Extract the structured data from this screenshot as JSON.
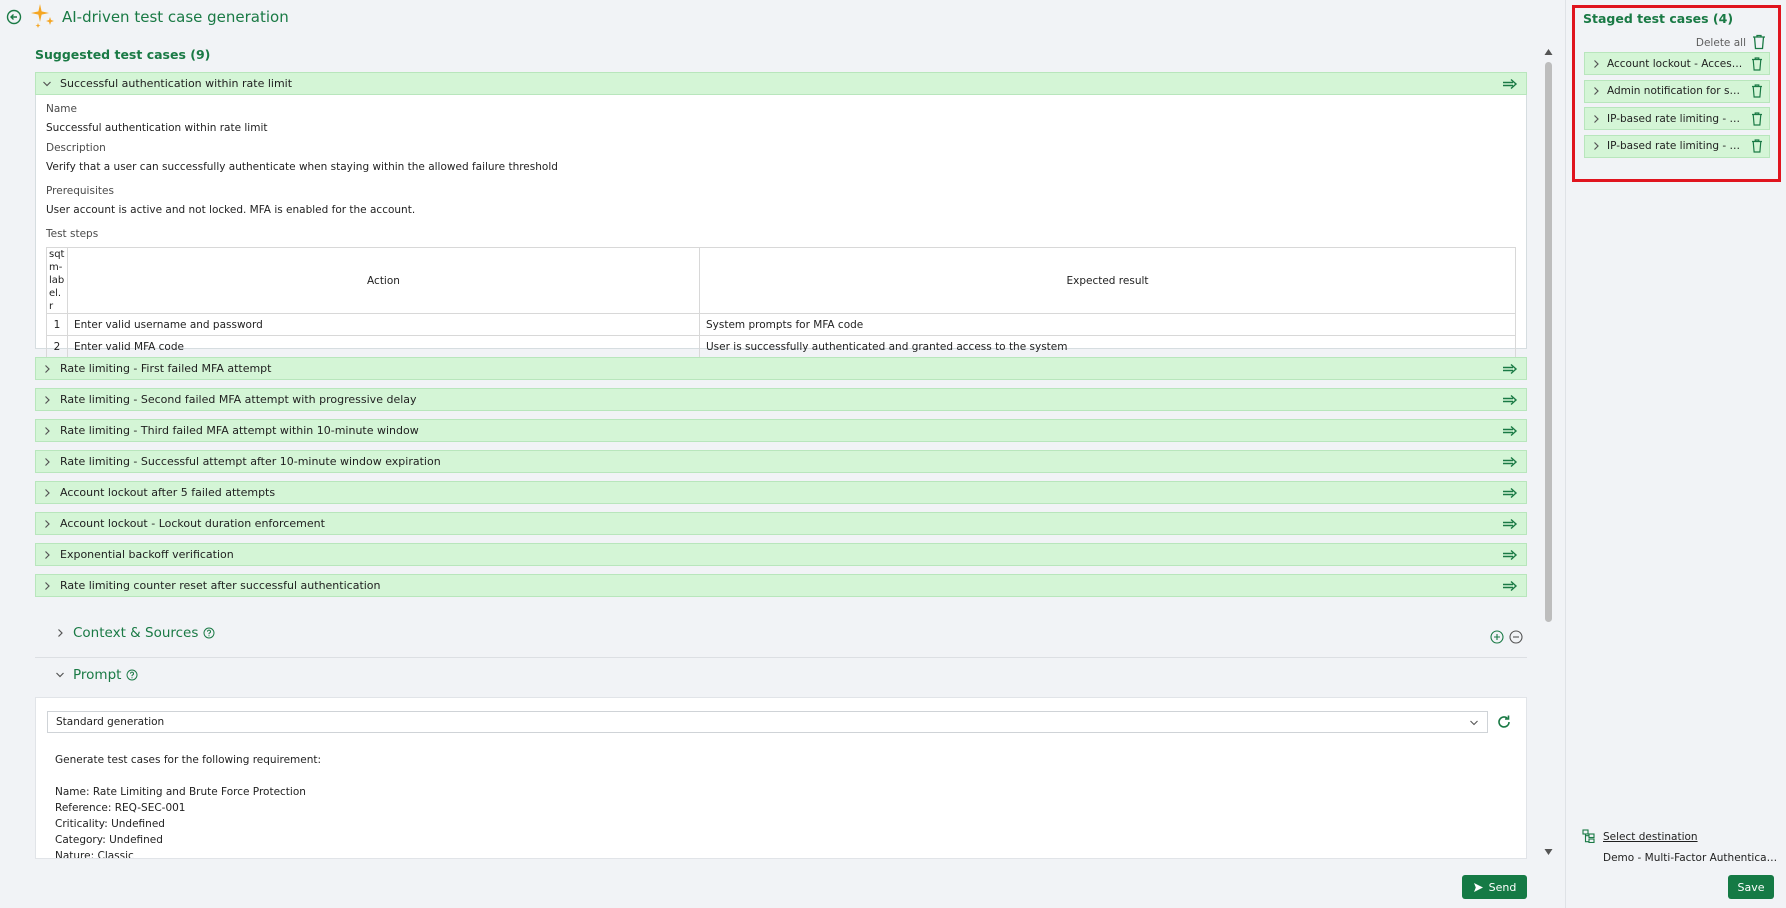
{
  "header": {
    "title": "AI-driven test case generation"
  },
  "suggested": {
    "title": "Suggested test cases (9)",
    "expanded": {
      "title": "Successful authentication within rate limit",
      "name_label": "Name",
      "name": "Successful authentication within rate limit",
      "description_label": "Description",
      "description": "Verify that a user can successfully authenticate when staying within the allowed failure threshold",
      "prerequisites_label": "Prerequisites",
      "prerequisites": "User account is active and not locked. MFA is enabled for the account.",
      "steps_label": "Test steps",
      "steps_columns": [
        "sqtm-label.r",
        "Action",
        "Expected result"
      ],
      "steps": [
        {
          "num": "1",
          "action": "Enter valid username and password",
          "expected": "System prompts for MFA code"
        },
        {
          "num": "2",
          "action": "Enter valid MFA code",
          "expected": "User is successfully authenticated and granted access to the system"
        }
      ]
    },
    "collapsed": [
      "Rate limiting - First failed MFA attempt",
      "Rate limiting - Second failed MFA attempt with progressive delay",
      "Rate limiting - Third failed MFA attempt within 10-minute window",
      "Rate limiting - Successful attempt after 10-minute window expiration",
      "Account lockout after 5 failed attempts",
      "Account lockout - Lockout duration enforcement",
      "Exponential backoff verification",
      "Rate limiting counter reset after successful authentication"
    ]
  },
  "context": {
    "title": "Context & Sources"
  },
  "prompt": {
    "title": "Prompt",
    "template": "Standard generation",
    "text": "Generate test cases for the following requirement:\n\nName: Rate Limiting and Brute Force Protection\nReference: REQ-SEC-001\nCriticality: Undefined\nCategory: Undefined\nNature: Classic"
  },
  "send_label": "Send",
  "staged": {
    "title": "Staged test cases (4)",
    "delete_all": "Delete all",
    "items": [
      "Account lockout - Access re...",
      "Admin notification for susp...",
      "IP-based rate limiting - Mul...",
      "IP-based rate limiting - Diff..."
    ]
  },
  "destination": {
    "link": "Select destination",
    "value": "Demo - Multi-Factor Authenticatio..."
  },
  "save_label": "Save",
  "colors": {
    "accent": "#1a7a45",
    "row_bg": "#d4f5d6",
    "highlight": "#e0141e"
  }
}
